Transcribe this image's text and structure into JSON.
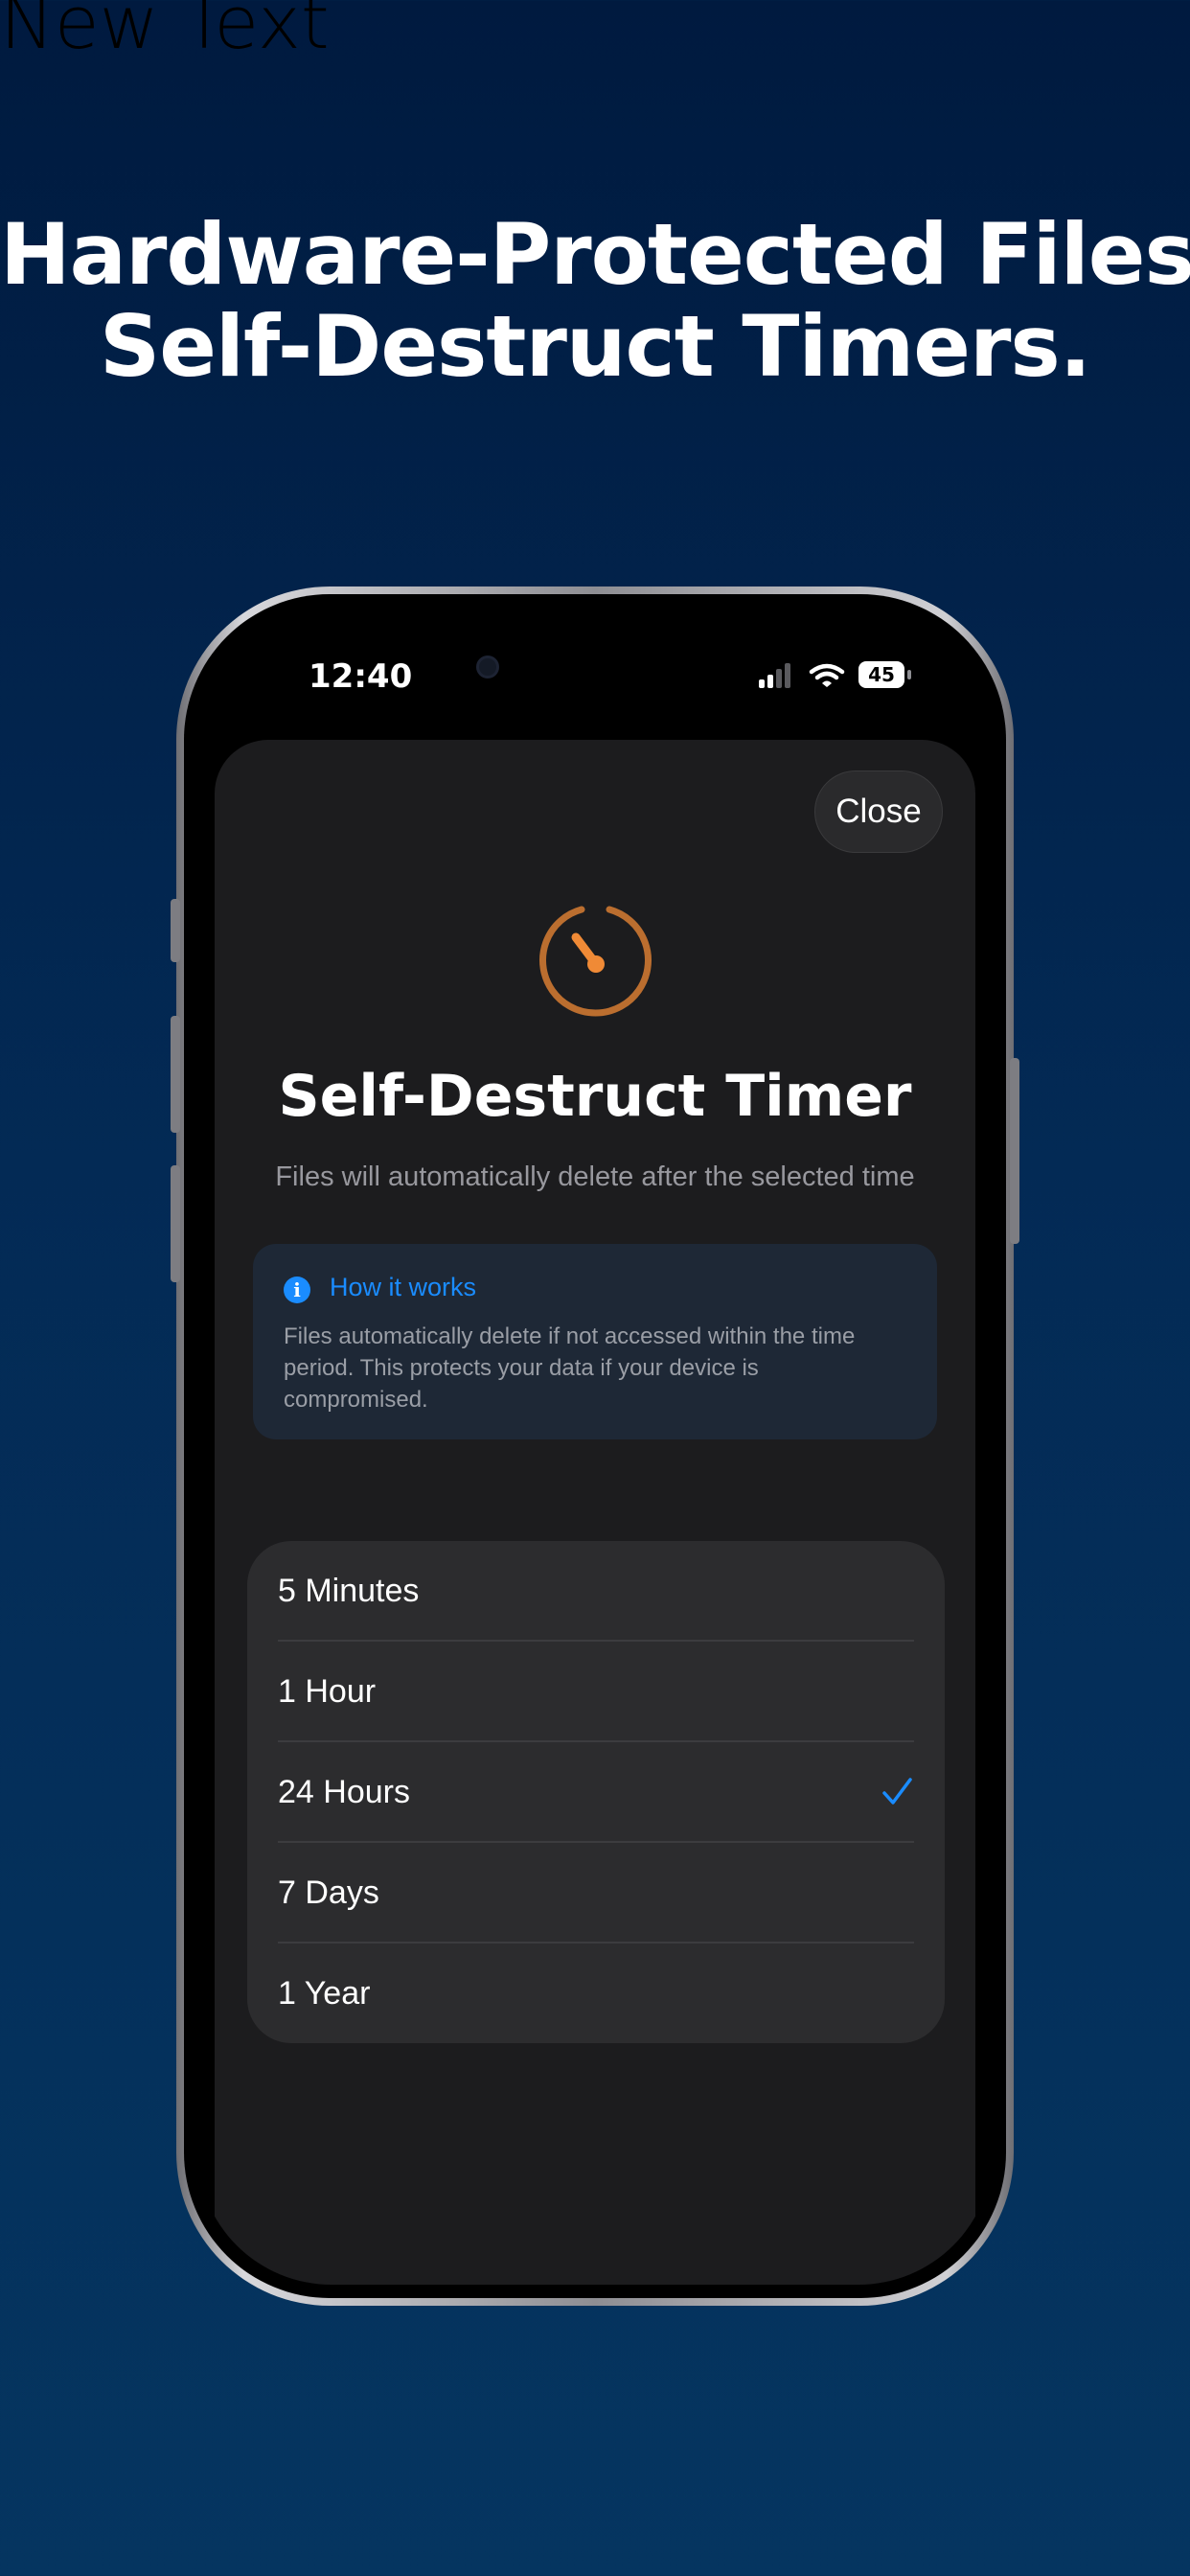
{
  "page": {
    "corner_text": "New Text",
    "headline_line1": "Hardware-Protected Files.",
    "headline_line2": "Self-Destruct Timers."
  },
  "status_bar": {
    "time": "12:40",
    "battery": "45",
    "icons": [
      "signal-icon",
      "wifi-icon",
      "battery-icon"
    ]
  },
  "sheet": {
    "close_label": "Close",
    "icon": "timer-icon",
    "title": "Self-Destruct Timer",
    "subtitle": "Files will automatically delete after the selected time",
    "info": {
      "icon": "info-icon",
      "title": "How it works",
      "text": "Files automatically delete if not accessed within the time period. This protects your data if your device is compromised."
    },
    "options": [
      {
        "label": "5 Minutes",
        "selected": false
      },
      {
        "label": "1 Hour",
        "selected": false
      },
      {
        "label": "24 Hours",
        "selected": true
      },
      {
        "label": "7 Days",
        "selected": false
      },
      {
        "label": "1 Year",
        "selected": false
      }
    ],
    "selected_option": "24 Hours"
  },
  "colors": {
    "background_top": "#001a3f",
    "background_bottom": "#053560",
    "accent_blue": "#1a8cff",
    "timer_orange": "#f08a36",
    "sheet_background": "#1c1c1e",
    "option_background": "#2c2c2e",
    "info_background": "#1e2836"
  }
}
